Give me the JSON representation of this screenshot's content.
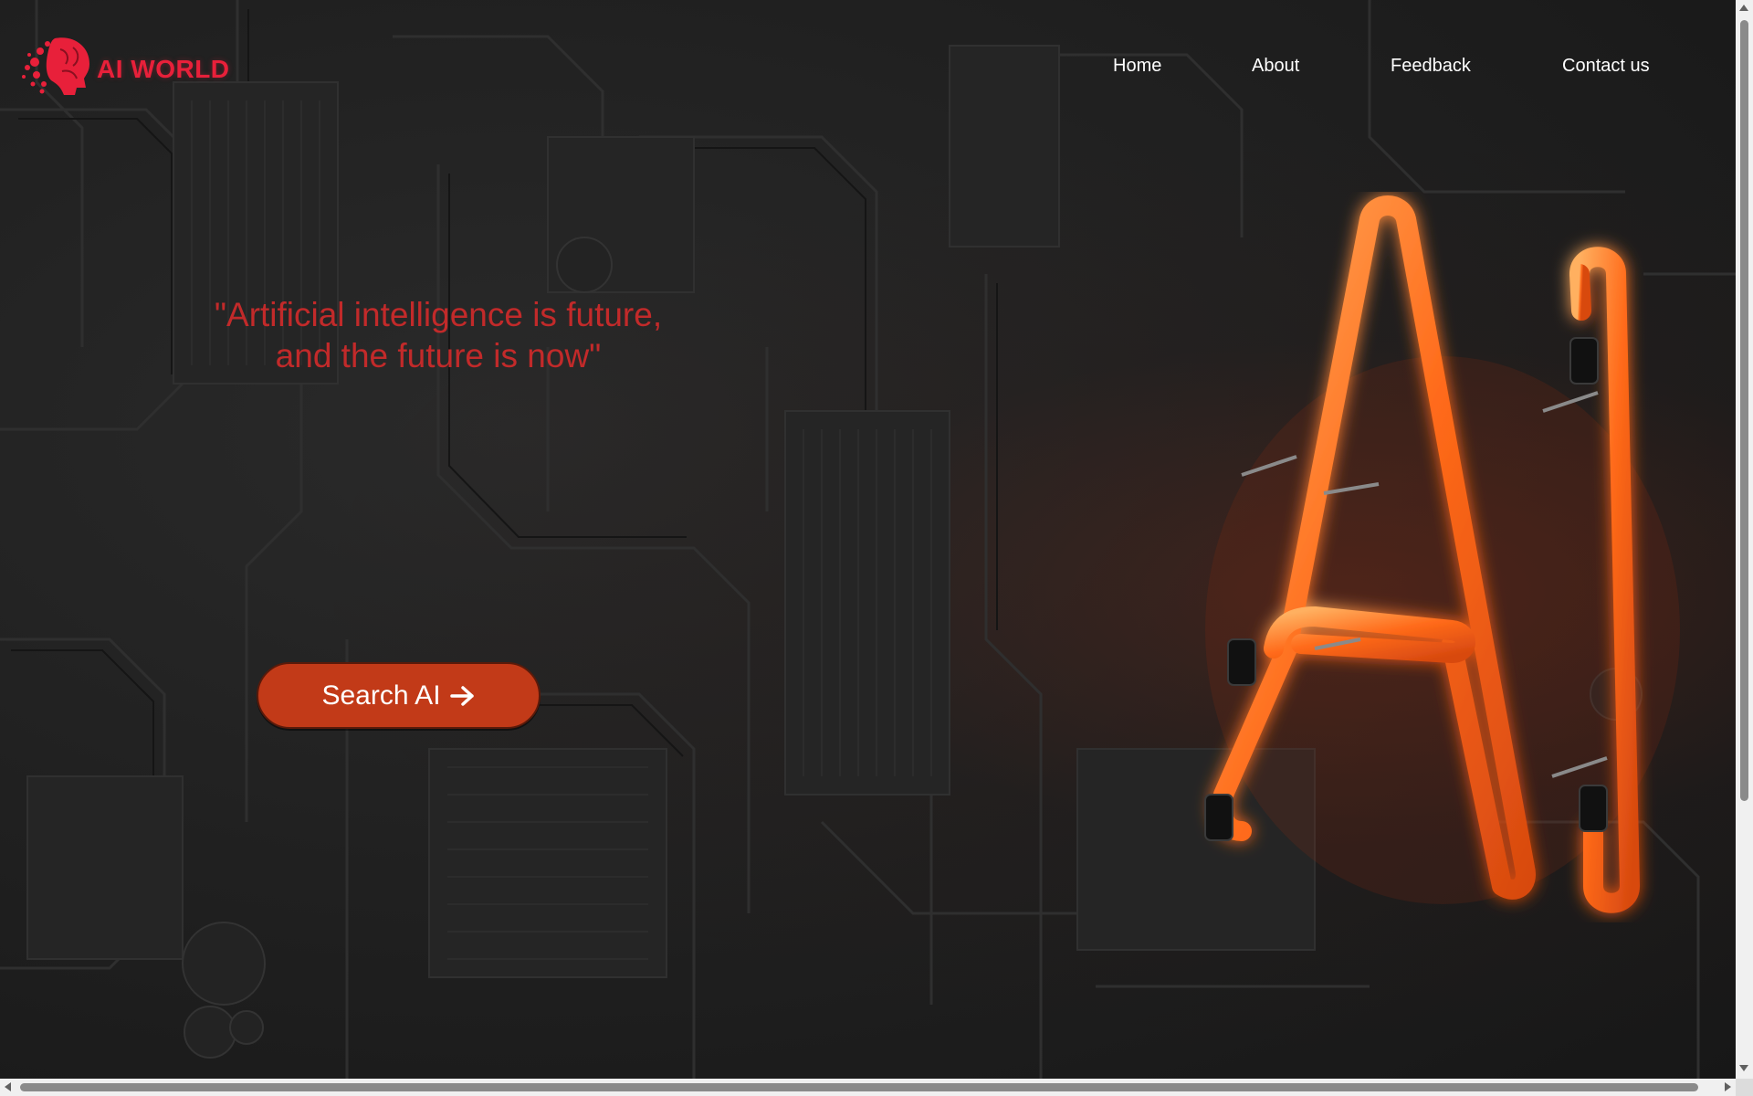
{
  "brand": {
    "name": "AI WORLD",
    "logo_icon": "ai-head-icon",
    "color": "#e8203a"
  },
  "nav": {
    "items": [
      {
        "label": "Home"
      },
      {
        "label": "About"
      },
      {
        "label": "Feedback"
      },
      {
        "label": "Contact us"
      }
    ]
  },
  "hero": {
    "quote_line1": "\"Artificial intelligence is future,",
    "quote_line2": "and the future is now\"",
    "quote_color": "#c22a2a",
    "cta_label": "Search AI",
    "cta_icon": "arrow-right-icon",
    "cta_color": "#c23a18",
    "neon_color": "#ff6a1a"
  }
}
